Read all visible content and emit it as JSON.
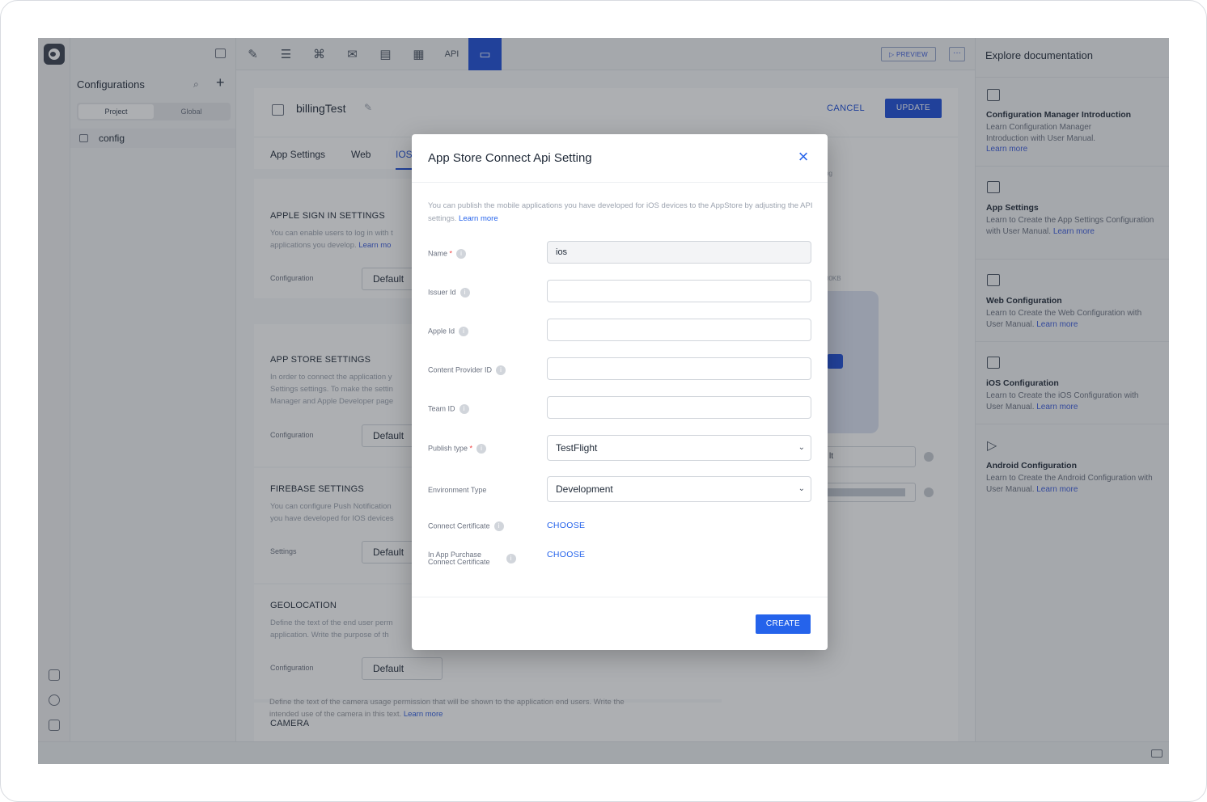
{
  "sidebar": {
    "title": "Configurations",
    "segments": [
      "Project",
      "Global"
    ],
    "items": [
      {
        "label": "config"
      }
    ]
  },
  "toolbar": {
    "api_label": "API",
    "preview_label": "▷ PREVIEW",
    "more_label": "···"
  },
  "header": {
    "title": "billingTest",
    "cancel_label": "CANCEL",
    "update_label": "UPDATE"
  },
  "tabs": [
    "App Settings",
    "Web",
    "IOS"
  ],
  "sections": [
    {
      "title": "APPLE SIGN IN SETTINGS",
      "desc": "You can enable users to log in with t",
      "desc2": "applications you develop.",
      "link": "Learn mo",
      "label": "Configuration",
      "value": "Default"
    },
    {
      "title": "APP STORE SETTINGS",
      "desc": "In order to connect the application y",
      "desc2": "Settings settings. To make the settin",
      "desc3": "Manager and Apple Developer page",
      "label": "Configuration",
      "value": "Default"
    },
    {
      "title": "FIREBASE SETTINGS",
      "desc": "You can configure Push Notification",
      "desc2": "you have developed for IOS devices",
      "label": "Settings",
      "value": "Default"
    },
    {
      "title": "GEOLOCATION",
      "desc": "Define the text of the end user perm",
      "desc2": "application. Write the purpose of th",
      "label": "Configuration",
      "value": "Default"
    },
    {
      "title": "CAMERA",
      "desc": "Define the text of the camera usage permission that will be shown to the application end users. Write the",
      "desc2": "intended use of the camera in this text.",
      "link": "Learn more"
    }
  ],
  "preview_panel": {
    "text1": "pg",
    "text2": "00KB",
    "select_value": "lt"
  },
  "docs": {
    "title": "Explore documentation",
    "items": [
      {
        "title": "Configuration Manager Introduction",
        "desc": "Learn Configuration Manager Introduction with User Manual.",
        "link": "Learn more"
      },
      {
        "title": "App Settings",
        "desc": "Learn to Create the App Settings Configuration with User Manual.",
        "link": "Learn more"
      },
      {
        "title": "Web Configuration",
        "desc": "Learn to Create the Web Configuration with User Manual.",
        "link": "Learn more"
      },
      {
        "title": "iOS Configuration",
        "desc": "Learn to Create the iOS Configuration with User Manual.",
        "link": "Learn more"
      },
      {
        "title": "Android Configuration",
        "desc": "Learn to Create the Android Configuration with User Manual.",
        "link": "Learn more"
      }
    ]
  },
  "modal": {
    "title": "App Store Connect Api Setting",
    "close_icon": "×",
    "desc": "You can publish the mobile applications you have developed for iOS devices to the AppStore by adjusting the API settings.",
    "desc_link": "Learn more",
    "fields": {
      "name": {
        "label": "Name",
        "required": "*",
        "value": "ios"
      },
      "issuer_id": {
        "label": "Issuer Id",
        "value": ""
      },
      "apple_id": {
        "label": "Apple Id",
        "value": ""
      },
      "content_provider_id": {
        "label": "Content Provider ID",
        "value": ""
      },
      "team_id": {
        "label": "Team ID",
        "value": ""
      },
      "publish_type": {
        "label": "Publish type",
        "required": "*",
        "value": "TestFlight"
      },
      "environment_type": {
        "label": "Environment Type",
        "value": "Development"
      },
      "connect_certificate": {
        "label": "Connect Certificate",
        "action": "CHOOSE"
      },
      "iap_certificate": {
        "label_line1": "In App Purchase",
        "label_line2": "Connect Certificate",
        "action": "CHOOSE"
      }
    },
    "create_label": "CREATE"
  },
  "colors": {
    "accent": "#2563eb",
    "active_tool": "#1d4ed8",
    "required": "#ef4444"
  }
}
